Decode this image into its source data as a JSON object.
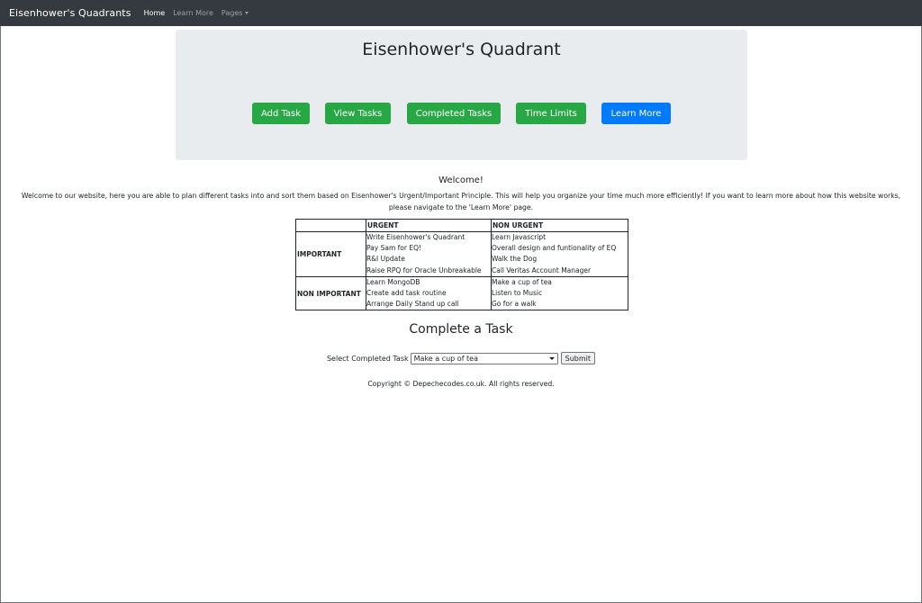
{
  "navbar": {
    "brand": "Eisenhower's Quadrants",
    "links": [
      "Home",
      "Learn More",
      "Pages"
    ]
  },
  "jumbotron": {
    "title": "Eisenhower's Quadrant",
    "buttons": [
      "Add Task",
      "View Tasks",
      "Completed Tasks",
      "Time Limits",
      "Learn More"
    ]
  },
  "welcome": {
    "title": "Welcome!",
    "text": "Welcome to our website, here you are able to plan different tasks into and sort them based on Eisenhower's Urgent/Important Principle. This will help you organize your time much more efficiently! If you want to learn more about how this website works, please navigate to the 'Learn More' page."
  },
  "table": {
    "headers": [
      "",
      "URGENT",
      "NON URGENT"
    ],
    "rows": [
      {
        "label": "IMPORTANT",
        "urgent": [
          "Write Eisenhower's Quadrant",
          "Pay Sam for EQ!",
          "R&I Update",
          "Raise RPQ for Oracle Unbreakable"
        ],
        "non_urgent": [
          "Learn Javascript",
          "Overall design and funtionality of EQ",
          "Walk the Dog",
          "Call Veritas Account Manager"
        ]
      },
      {
        "label": "NON IMPORTANT",
        "urgent": [
          "Learn MongoDB",
          "Create add task routine",
          "Arrange Daily Stand up call"
        ],
        "non_urgent": [
          "Make a cup of tea",
          "Listen to Music",
          "Go for a walk"
        ]
      }
    ]
  },
  "complete": {
    "title": "Complete a Task",
    "label": "Select Completed Task",
    "selected": "Make a cup of tea",
    "submit": "Submit"
  },
  "footer": "Copyright © Depechecodes.co.uk. All rights reserved.",
  "colors": {
    "navbar": "#343a40",
    "jumbotron": "#e9ecef",
    "green": "#28a745",
    "blue": "#007bff"
  }
}
